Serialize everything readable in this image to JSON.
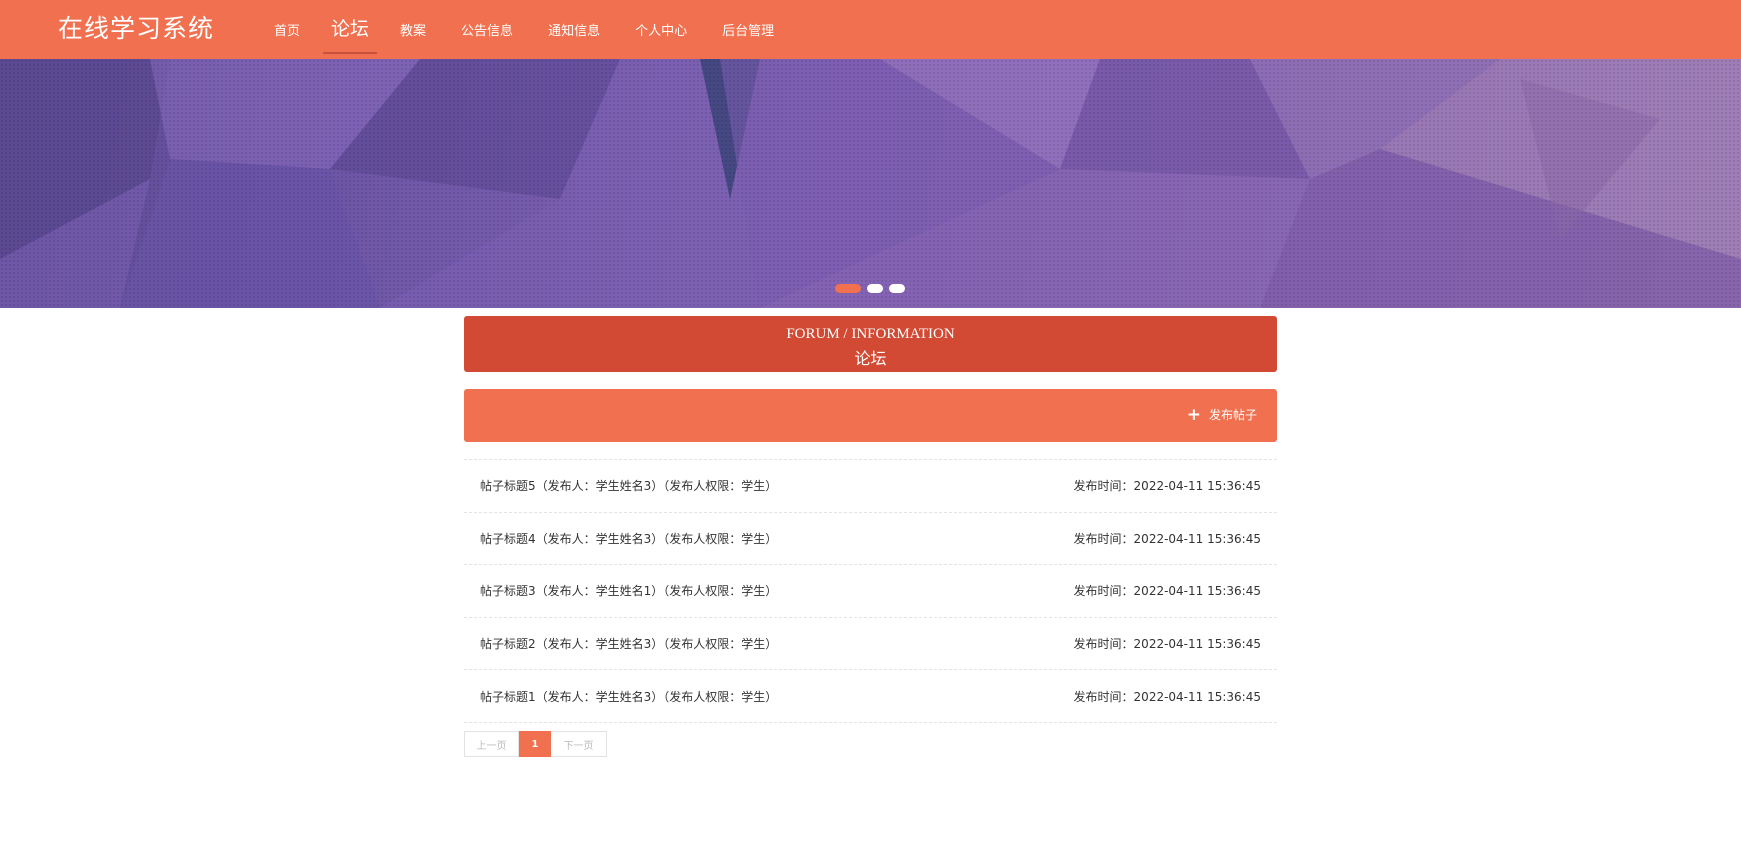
{
  "header": {
    "brand": "在线学习系统",
    "nav": [
      {
        "label": "首页",
        "active": false
      },
      {
        "label": "论坛",
        "active": true
      },
      {
        "label": "教案",
        "active": false
      },
      {
        "label": "公告信息",
        "active": false
      },
      {
        "label": "通知信息",
        "active": false
      },
      {
        "label": "个人中心",
        "active": false
      },
      {
        "label": "后台管理",
        "active": false
      }
    ]
  },
  "banner": {
    "slide_count": 3,
    "active_slide": 1
  },
  "section": {
    "title_en": "FORUM / INFORMATION",
    "title_zh": "论坛"
  },
  "actions": {
    "post_icon": "plus-icon",
    "post_label": "发布帖子"
  },
  "posts": [
    {
      "title": "帖子标题5（发布人：学生姓名3）（发布人权限：学生）",
      "time": "发布时间：2022-04-11 15:36:45"
    },
    {
      "title": "帖子标题4（发布人：学生姓名3）（发布人权限：学生）",
      "time": "发布时间：2022-04-11 15:36:45"
    },
    {
      "title": "帖子标题3（发布人：学生姓名1）（发布人权限：学生）",
      "time": "发布时间：2022-04-11 15:36:45"
    },
    {
      "title": "帖子标题2（发布人：学生姓名3）（发布人权限：学生）",
      "time": "发布时间：2022-04-11 15:36:45"
    },
    {
      "title": "帖子标题1（发布人：学生姓名3）（发布人权限：学生）",
      "time": "发布时间：2022-04-11 15:36:45"
    }
  ],
  "pagination": {
    "prev": "上一页",
    "current": "1",
    "next": "下一页"
  },
  "colors": {
    "primary": "#f0704f",
    "title_bg": "#d24a33",
    "banner": "#7c5fb0"
  }
}
